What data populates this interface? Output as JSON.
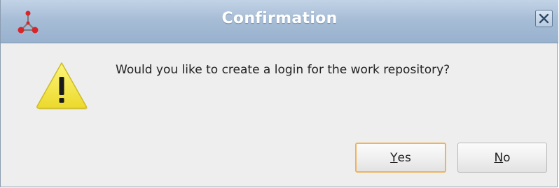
{
  "dialog": {
    "title": "Confirmation",
    "message": "Would you like to create a login for the work repository?",
    "icons": {
      "app": "odi-app-icon",
      "close": "close-icon",
      "message": "warning-icon"
    },
    "buttons": {
      "yes": {
        "mnemonic": "Y",
        "rest": "es",
        "default": true
      },
      "no": {
        "mnemonic": "N",
        "rest": "o",
        "default": false
      }
    }
  },
  "colors": {
    "titlebar": "#a7bdd6",
    "title_text": "#ffffff",
    "dialog_bg": "#eeeeee",
    "default_button_border": "#f0b35a",
    "warning_fill": "#f7e94a"
  }
}
